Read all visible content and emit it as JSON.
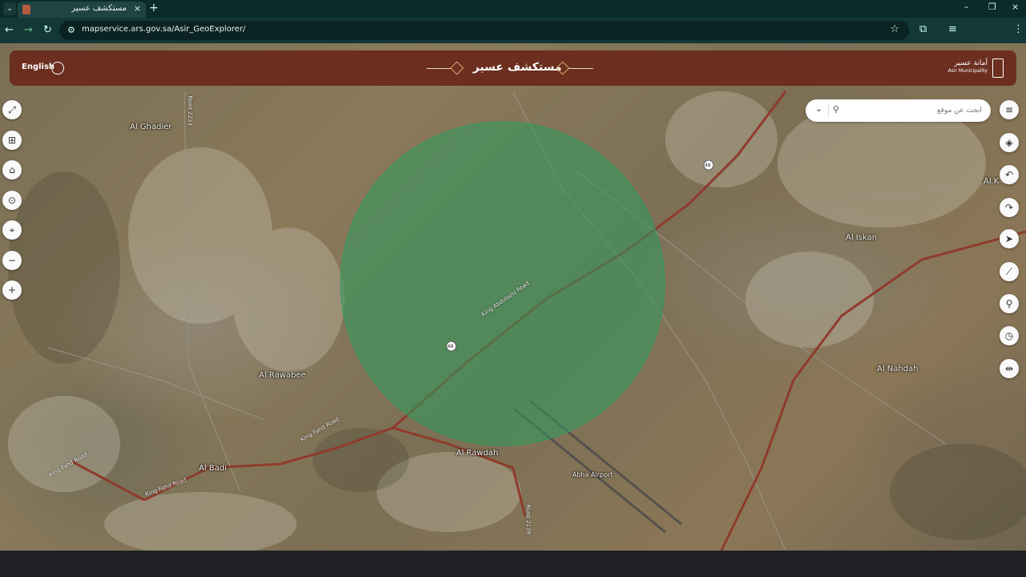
{
  "browser": {
    "tab_title": "مستكشف عسير",
    "tab_close": "×",
    "new_tab": "+",
    "url": "mapservice.ars.gov.sa/Asir_GeoExplorer/",
    "window_controls": [
      "–",
      "❐",
      "×"
    ]
  },
  "header": {
    "language_label": "English",
    "app_title": "مستكشف عسير",
    "org_name_ar": "أمانة عسير",
    "org_name_en": "Asir Municipality",
    "background_color": "#6b2e1f"
  },
  "search": {
    "placeholder": "ابحث عن موقع"
  },
  "left_tools": [
    {
      "name": "fullscreen-icon",
      "glyph": "⤢"
    },
    {
      "name": "book-icon",
      "glyph": "⊞"
    },
    {
      "name": "home-icon",
      "glyph": "⌂"
    },
    {
      "name": "screenshot-icon",
      "glyph": "⊙"
    },
    {
      "name": "locate-icon",
      "glyph": "⌖"
    },
    {
      "name": "zoom-out-icon",
      "glyph": "−"
    },
    {
      "name": "zoom-in-icon",
      "glyph": "+"
    }
  ],
  "right_tools": [
    {
      "name": "panel-toggle-icon",
      "glyph": "≡"
    },
    {
      "name": "layers-icon",
      "glyph": "◈"
    },
    {
      "name": "undo-icon",
      "glyph": "↶"
    },
    {
      "name": "redo-icon",
      "glyph": "↷"
    },
    {
      "name": "navigate-icon",
      "glyph": "➤"
    },
    {
      "name": "measure-icon",
      "glyph": "⟋"
    },
    {
      "name": "map-search-icon",
      "glyph": "⚲"
    },
    {
      "name": "time-icon",
      "glyph": "◷"
    },
    {
      "name": "compare-icon",
      "glyph": "⇹"
    }
  ],
  "places": [
    "Al Ghadier",
    "Al Iskan",
    "Al Rawabee",
    "Al Nahdah",
    "Al Badi",
    "Al Rawdah",
    "Abha Airport",
    "Al K"
  ],
  "roads": [
    "King Fahd Road",
    "King Fahd Road",
    "King Fahd Road",
    "King Abdulaziz Road",
    "Road 2139",
    "Road 2233"
  ],
  "route_markers": [
    "48",
    "48"
  ],
  "buffer_color": "#2e9a5e"
}
